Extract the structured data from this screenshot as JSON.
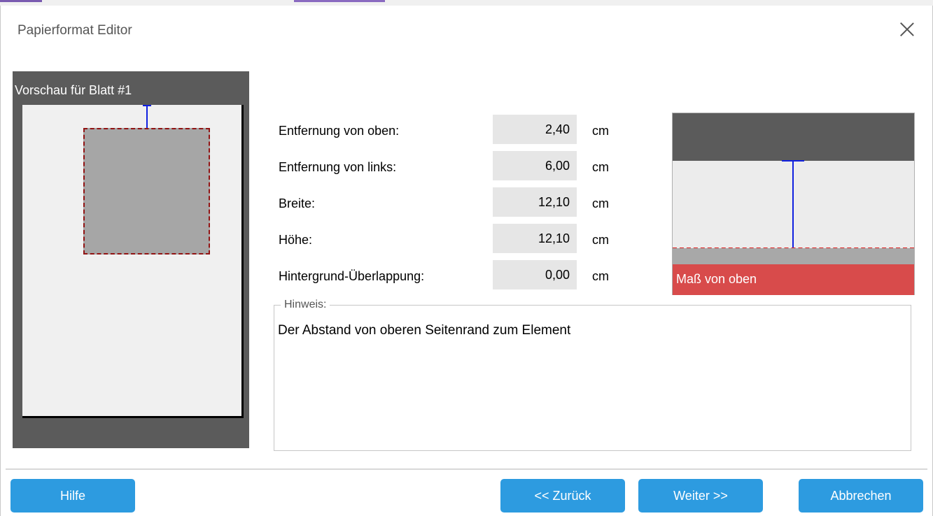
{
  "window": {
    "title": "Papierformat Editor"
  },
  "preview": {
    "title": "Vorschau für Blatt #1"
  },
  "fields": [
    {
      "label": "Entfernung von oben:",
      "value": "2,40",
      "unit": "cm"
    },
    {
      "label": "Entfernung von links:",
      "value": "6,00",
      "unit": "cm"
    },
    {
      "label": "Breite:",
      "value": "12,10",
      "unit": "cm"
    },
    {
      "label": "Höhe:",
      "value": "12,10",
      "unit": "cm"
    },
    {
      "label": "Hintergrund-Überlappung:",
      "value": "0,00",
      "unit": "cm"
    }
  ],
  "illustration": {
    "caption": "Maß von oben"
  },
  "hint": {
    "legend": "Hinweis:",
    "text": "Der Abstand von oberen Seitenrand zum Element"
  },
  "buttons": {
    "help": "Hilfe",
    "back": "<< Zurück",
    "next": "Weiter >>",
    "cancel": "Abbrechen"
  },
  "colors": {
    "button": "#2d9be0",
    "preview_bg": "#5b5b5b",
    "measure_line": "#1020e0",
    "highlight": "#d84b4b"
  }
}
